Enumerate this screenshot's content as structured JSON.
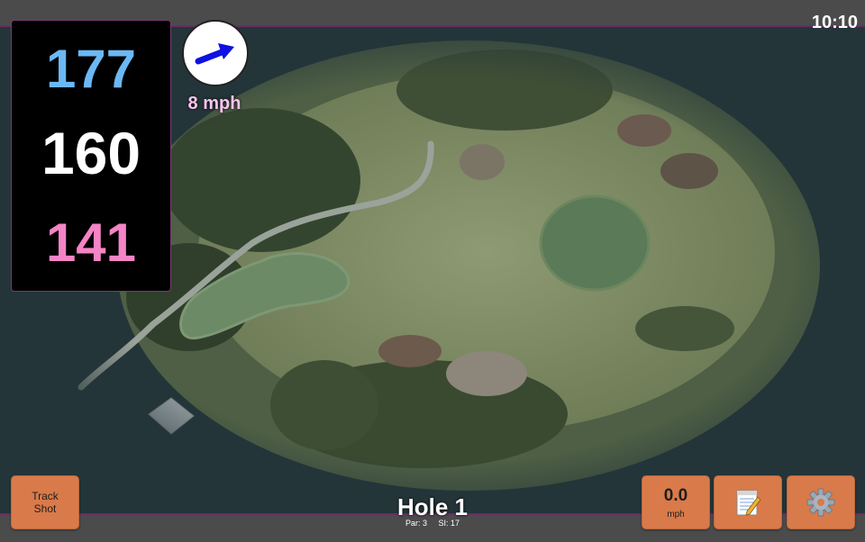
{
  "status_bar": {
    "time": "10:10"
  },
  "distances": {
    "back": "177",
    "center": "160",
    "front": "141"
  },
  "wind": {
    "speed": "8 mph",
    "icon": "arrow-icon",
    "arrow_color": "#1010e0"
  },
  "hole": {
    "title": "Hole 1",
    "par": "Par: 3",
    "si": "SI: 17"
  },
  "buttons": {
    "track_shot": {
      "line1": "Track",
      "line2": "Shot"
    },
    "speed": {
      "value": "0.0",
      "unit": "mph"
    },
    "notes": {
      "icon": "notepad-icon"
    },
    "settings": {
      "icon": "gear-icon"
    }
  },
  "colors": {
    "back_distance": "#6cb8f4",
    "center_distance": "#ffffff",
    "front_distance": "#f484c6",
    "wind_label": "#f8c4f0",
    "button": "#d97a4a",
    "border_accent": "#6a2c63"
  }
}
